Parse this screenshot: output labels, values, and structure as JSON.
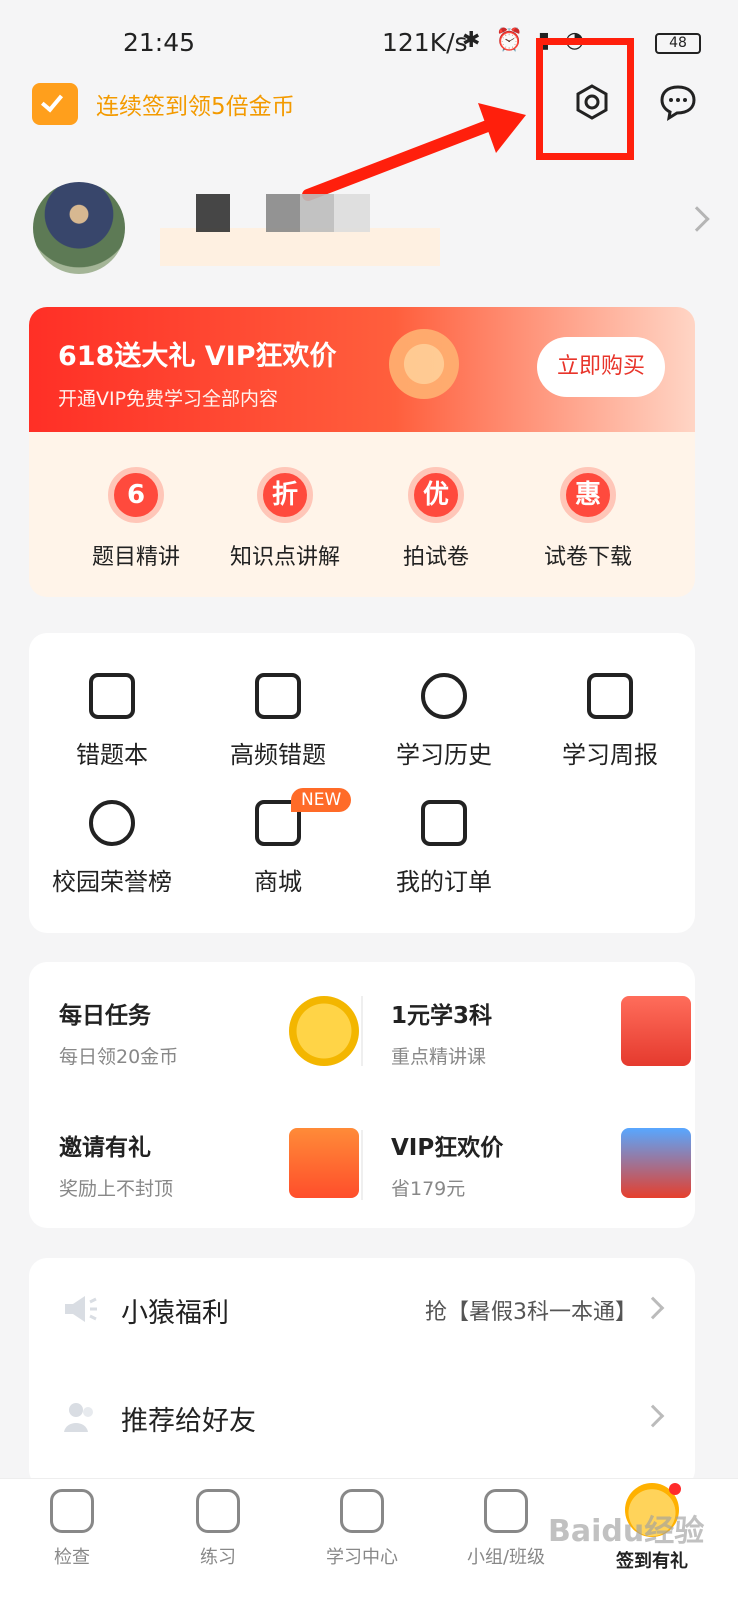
{
  "status_bar": {
    "time": "21:45",
    "network_speed": "121K/s",
    "battery": "48",
    "icons": [
      "bluetooth-icon",
      "alarm-icon",
      "hd-signal-icon",
      "wifi-icon",
      "battery-icon"
    ]
  },
  "header": {
    "checkin_promo": "连续签到领5倍金币",
    "settings_icon": "settings-icon",
    "message_icon": "message-icon"
  },
  "profile": {
    "chevron_icon": "chevron-right-icon"
  },
  "vip_banner": {
    "title": "618送大礼 VIP狂欢价",
    "subtitle": "开通VIP免费学习全部内容",
    "button": "立即购买",
    "features": [
      {
        "icon_text": "6",
        "label": "题目精讲"
      },
      {
        "icon_text": "折",
        "label": "知识点讲解"
      },
      {
        "icon_text": "优",
        "label": "拍试卷"
      },
      {
        "icon_text": "惠",
        "label": "试卷下载"
      }
    ]
  },
  "tools": {
    "items": [
      {
        "label": "错题本",
        "icon": "wrong-book-icon"
      },
      {
        "label": "高频错题",
        "icon": "frequent-error-icon"
      },
      {
        "label": "学习历史",
        "icon": "clock-icon"
      },
      {
        "label": "学习周报",
        "icon": "weekly-report-icon"
      },
      {
        "label": "校园荣誉榜",
        "icon": "trophy-icon"
      },
      {
        "label": "商城",
        "icon": "shop-icon",
        "badge": "NEW"
      },
      {
        "label": "我的订单",
        "icon": "order-icon"
      }
    ]
  },
  "activities": {
    "items": [
      {
        "title": "每日任务",
        "subtitle": "每日领20金币",
        "icon": "coin-icon"
      },
      {
        "title": "1元学3科",
        "subtitle": "重点精讲课",
        "icon": "book-icon"
      },
      {
        "title": "邀请有礼",
        "subtitle": "奖励上不封顶",
        "icon": "gift-envelope-icon"
      },
      {
        "title": "VIP狂欢价",
        "subtitle": "省179元",
        "icon": "vip-gift-icon"
      }
    ]
  },
  "list": {
    "items": [
      {
        "label": "小猿福利",
        "extra": "抢【暑假3科一本通】",
        "icon": "speaker-icon"
      },
      {
        "label": "推荐给好友",
        "extra": "",
        "icon": "friends-icon"
      }
    ]
  },
  "tabbar": {
    "items": [
      {
        "label": "检查",
        "icon": "camera-icon"
      },
      {
        "label": "练习",
        "icon": "pencil-icon"
      },
      {
        "label": "学习中心",
        "icon": "study-center-icon"
      },
      {
        "label": "小组/班级",
        "icon": "group-icon"
      },
      {
        "label": "签到有礼",
        "icon": "checkin-mascot-icon"
      }
    ]
  },
  "watermark": "Baidu经验"
}
